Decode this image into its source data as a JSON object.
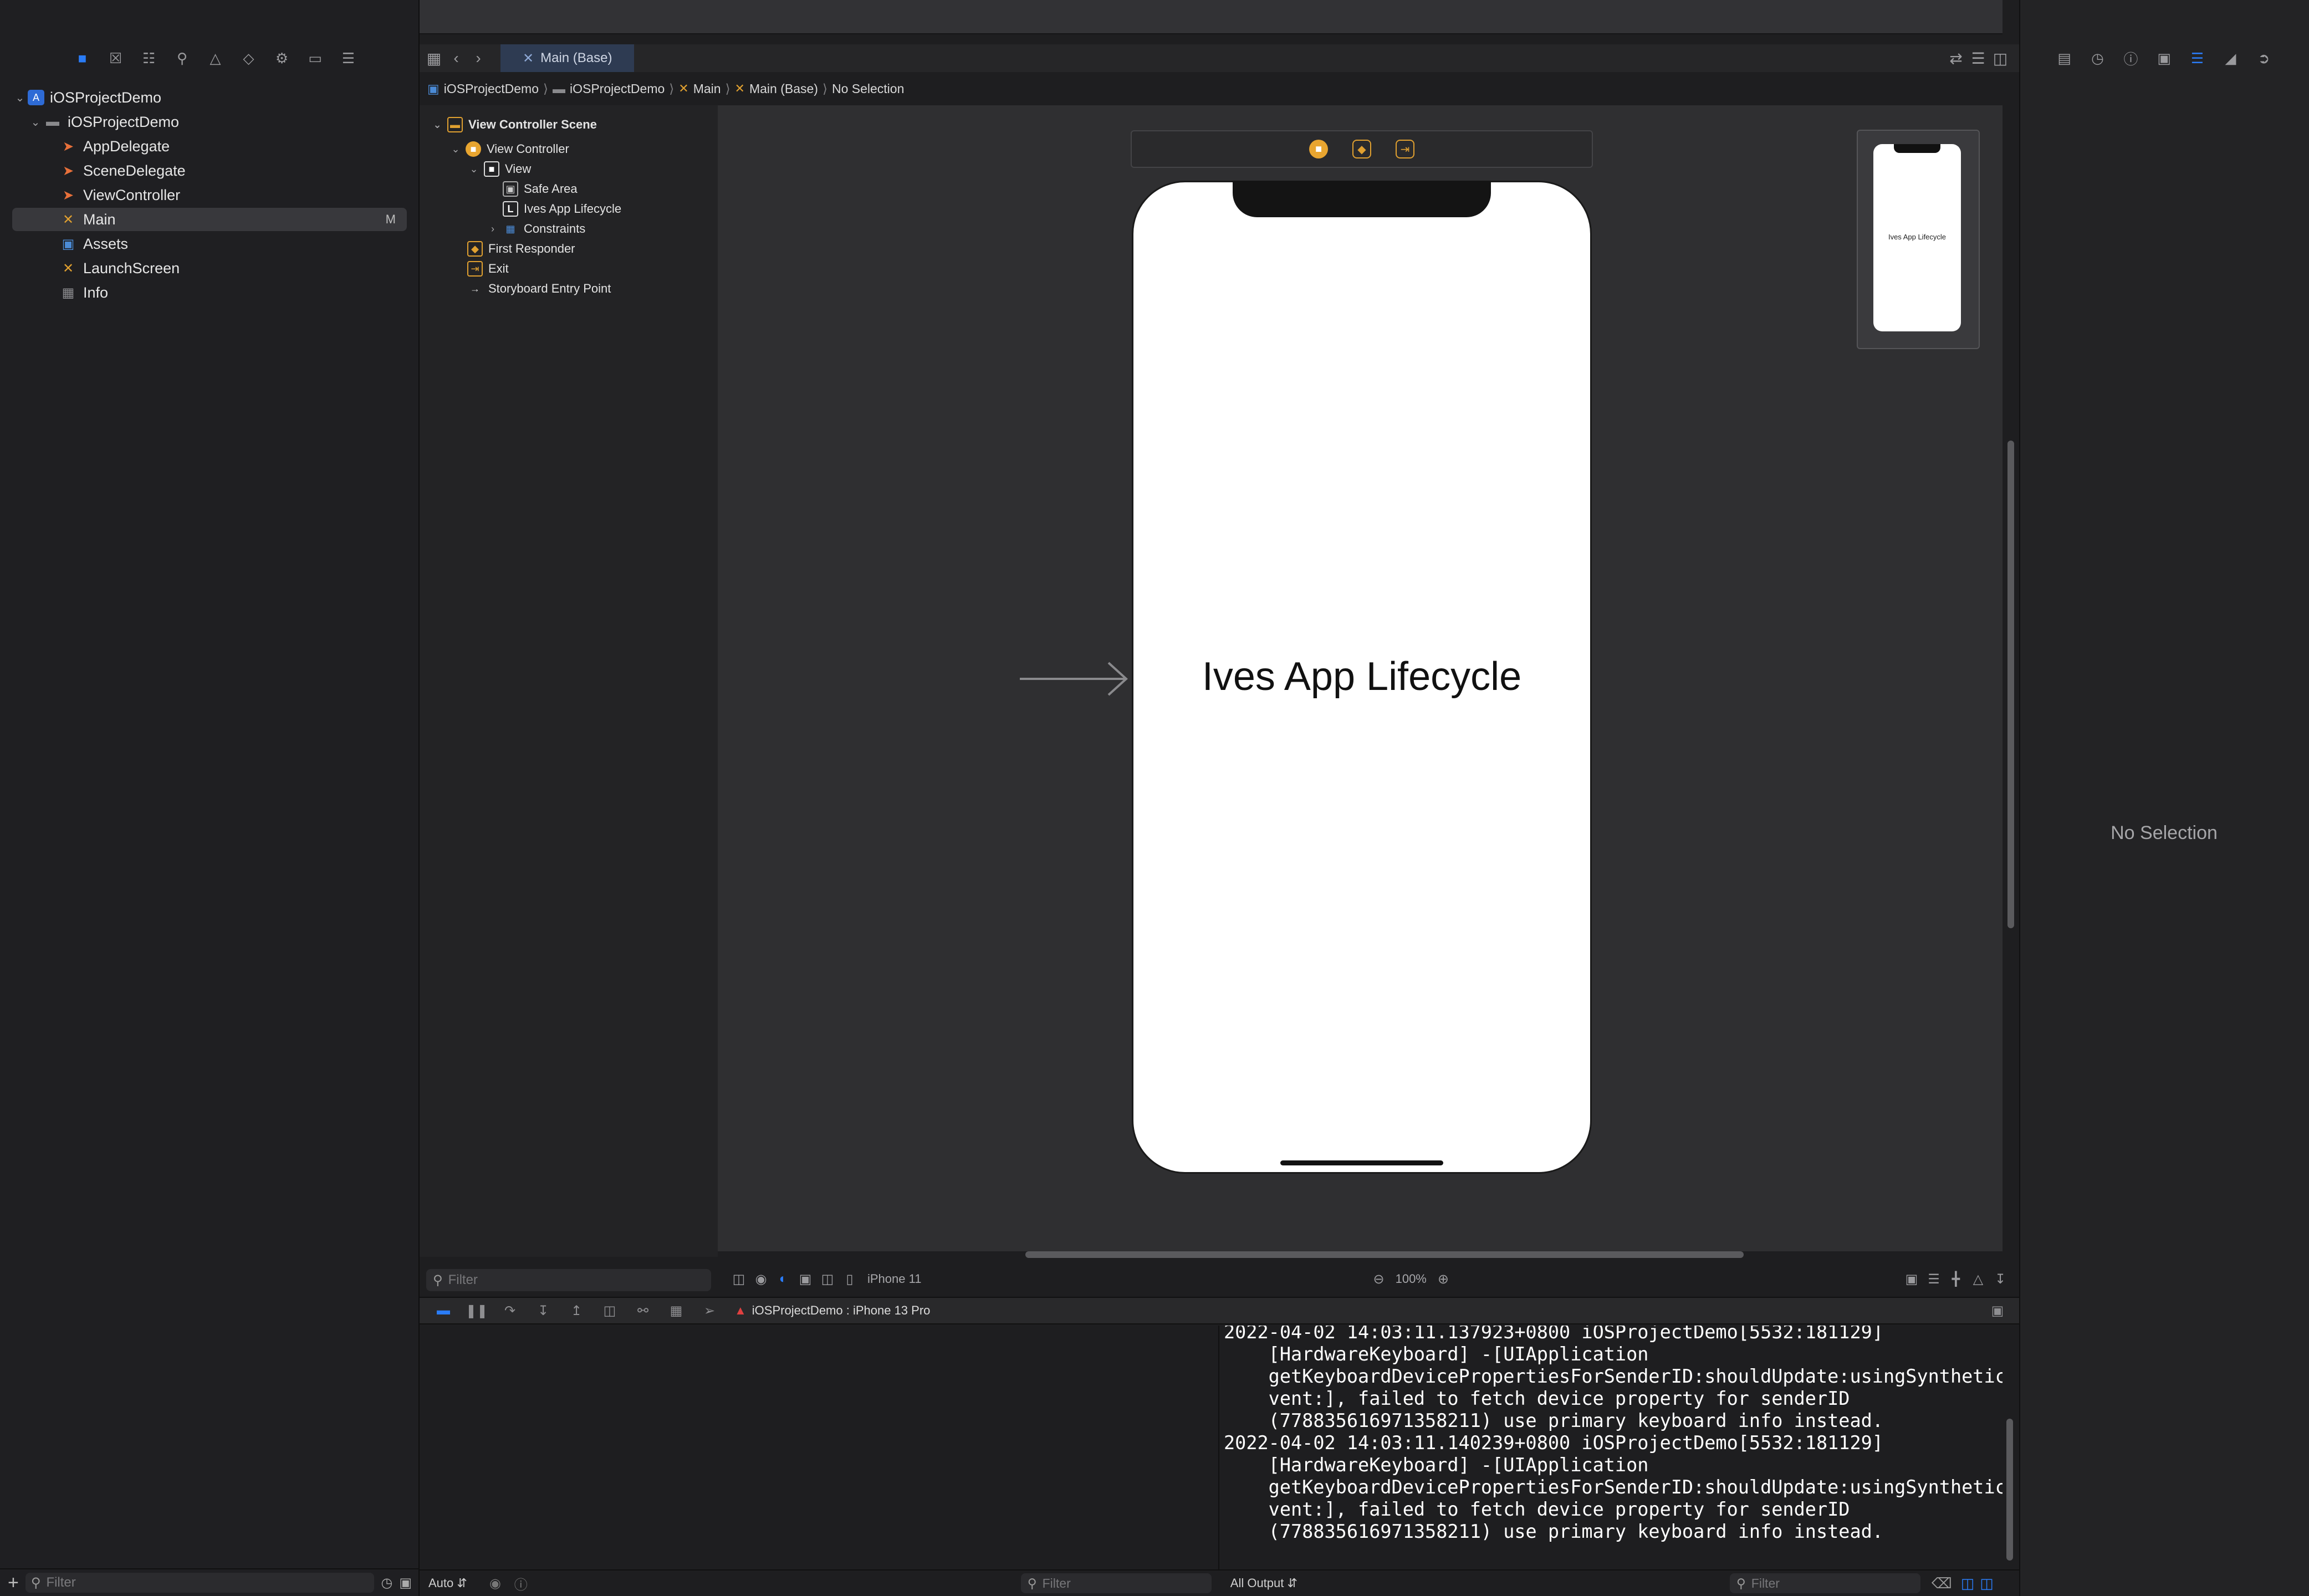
{
  "navigator": {
    "toolbar_icons": [
      "folder-icon",
      "source-control-icon",
      "symbol-icon",
      "find-icon",
      "issue-icon",
      "test-icon",
      "debug-icon",
      "breakpoint-icon",
      "report-icon"
    ],
    "items": [
      {
        "label": "iOSProjectDemo",
        "badge": ""
      },
      {
        "label": "iOSProjectDemo",
        "badge": ""
      },
      {
        "label": "AppDelegate",
        "badge": ""
      },
      {
        "label": "SceneDelegate",
        "badge": ""
      },
      {
        "label": "ViewController",
        "badge": ""
      },
      {
        "label": "Main",
        "badge": "M"
      },
      {
        "label": "Assets",
        "badge": ""
      },
      {
        "label": "LaunchScreen",
        "badge": ""
      },
      {
        "label": "Info",
        "badge": ""
      }
    ],
    "filter_placeholder": "Filter"
  },
  "editor": {
    "tab_label": "Main (Base)",
    "breadcrumb": [
      "iOSProjectDemo",
      "iOSProjectDemo",
      "Main",
      "Main (Base)",
      "No Selection"
    ]
  },
  "outline": {
    "items": [
      "View Controller Scene",
      "View Controller",
      "View",
      "Safe Area",
      "Ives App Lifecycle",
      "Constraints",
      "First Responder",
      "Exit",
      "Storyboard Entry Point"
    ],
    "filter_placeholder": "Filter"
  },
  "canvas": {
    "label_text": "Ives App Lifecycle",
    "device": "iPhone 11",
    "zoom": "100%"
  },
  "debug": {
    "target": "iOSProjectDemo : iPhone 13 Pro"
  },
  "console": {
    "lines": "2022-04-02 14:03:11.137923+0800 iOSProjectDemo[5532:181129]\n    [HardwareKeyboard] -[UIApplication\n    getKeyboardDevicePropertiesForSenderID:shouldUpdate:usingSyntheticE\n    vent:], failed to fetch device property for senderID\n    (778835616971358211) use primary keyboard info instead.\n2022-04-02 14:03:11.140239+0800 iOSProjectDemo[5532:181129]\n    [HardwareKeyboard] -[UIApplication\n    getKeyboardDevicePropertiesForSenderID:shouldUpdate:usingSyntheticE\n    vent:], failed to fetch device property for senderID\n    (778835616971358211) use primary keyboard info instead.",
    "output_select": "All Output",
    "filter_placeholder": "Filter"
  },
  "variables": {
    "scope_select": "Auto",
    "filter_placeholder": "Filter"
  },
  "inspector": {
    "empty_text": "No Selection"
  },
  "colors": {
    "accent": "#2a7cf7",
    "storyboard": "#e0a030"
  }
}
